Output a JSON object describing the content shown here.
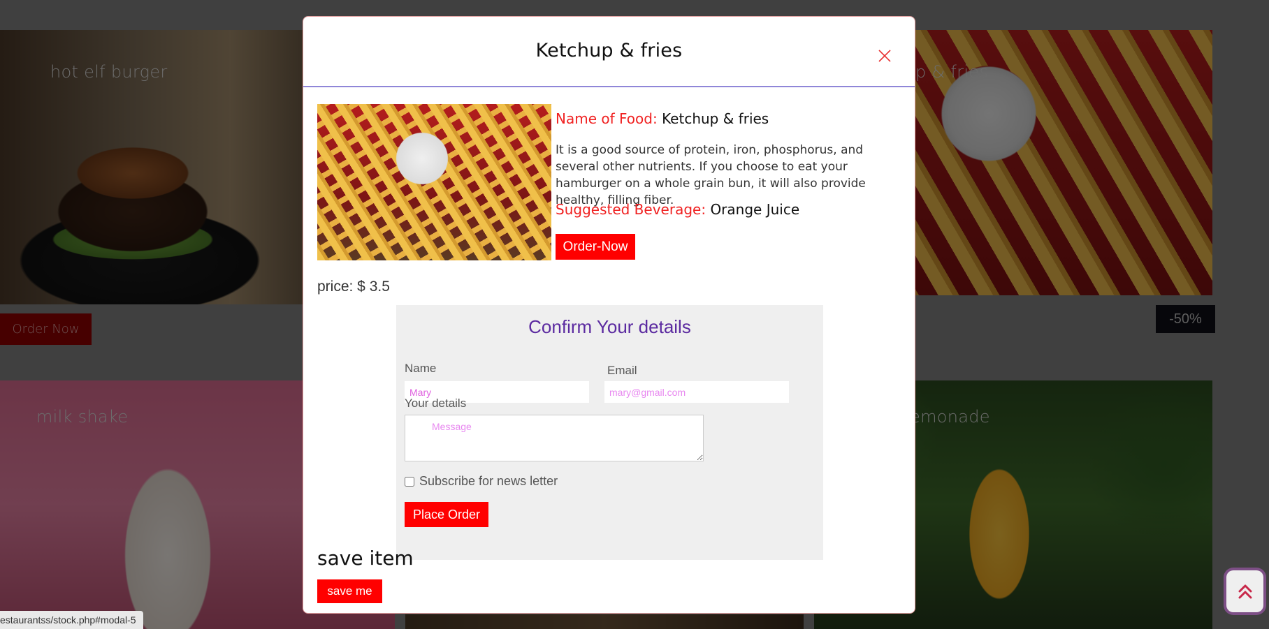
{
  "background": {
    "cards": [
      {
        "title": "hot elf burger"
      },
      {
        "title": "p & fries"
      },
      {
        "title": "milk shake"
      },
      {
        "title": "emonade"
      }
    ],
    "order_now_label": "Order Now",
    "discount_badge": "-50%"
  },
  "modal": {
    "title": "Ketchup & fries",
    "name_key": "Name of Food:",
    "name_value": "Ketchup & fries",
    "description": "It is a good source of protein, iron, phosphorus, and several other nutrients. If you choose to eat your hamburger on a whole grain bun, it will also provide healthy, filling fiber.",
    "beverage_key": "Suggested Beverage:",
    "beverage_value": "Orange Juice",
    "order_now_label": "Order-Now",
    "price": "price: $ 3.5",
    "form": {
      "title": "Confirm Your details",
      "name_label": "Name",
      "name_value": "Mary",
      "email_label": "Email",
      "email_placeholder": "mary@gmail.com",
      "details_label": "Your details",
      "details_placeholder": "Message",
      "subscribe_label": "Subscribe for news letter",
      "subscribe_checked": false,
      "place_order_label": "Place Order"
    },
    "save_heading": "save item",
    "save_label": "save me"
  },
  "status_url": "estaurantss/stock.php#modal-5",
  "colors": {
    "accent_red": "#ff0000",
    "form_title_purple": "#5b2aa0",
    "header_divider": "#8f86d8",
    "input_text_pink": "#e060e0"
  },
  "icons": {
    "close": "close-icon",
    "scroll_top": "double-chevron-up-icon"
  }
}
